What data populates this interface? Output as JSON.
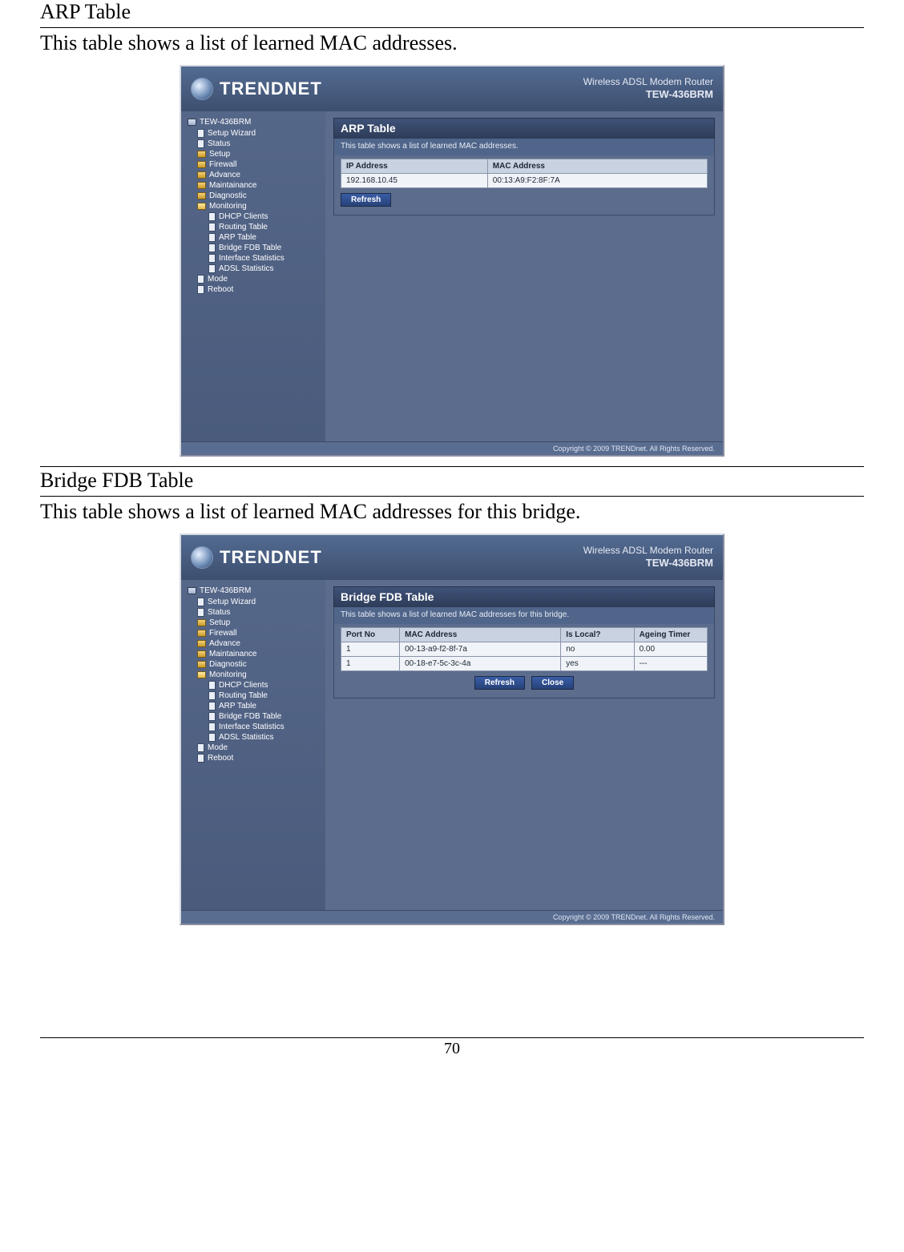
{
  "page": {
    "number": "70"
  },
  "section1": {
    "title": "ARP Table",
    "desc": "This table shows a list of learned MAC addresses."
  },
  "section2": {
    "title": "Bridge FDB Table",
    "desc": "This table shows a list of learned MAC addresses for this bridge."
  },
  "brand": {
    "name": "TRENDNET",
    "product": "Wireless ADSL Modem Router",
    "model": "TEW-436BRM",
    "footer": "Copyright © 2009 TRENDnet. All Rights Reserved."
  },
  "nav": {
    "root": "TEW-436BRM",
    "items": [
      "Setup Wizard",
      "Status",
      "Setup",
      "Firewall",
      "Advance",
      "Maintainance",
      "Diagnostic",
      "Monitoring"
    ],
    "sub": [
      "DHCP Clients",
      "Routing Table",
      "ARP Table",
      "Bridge FDB Table",
      "Interface Statistics",
      "ADSL Statistics"
    ],
    "tail": [
      "Mode",
      "Reboot"
    ]
  },
  "arp": {
    "panelTitle": "ARP Table",
    "panelDesc": "This table shows a list of learned MAC addresses.",
    "headers": {
      "ip": "IP Address",
      "mac": "MAC Address"
    },
    "rows": [
      {
        "ip": "192.168.10.45",
        "mac": "00:13:A9:F2:8F:7A"
      }
    ],
    "refresh": "Refresh"
  },
  "fdb": {
    "panelTitle": "Bridge FDB Table",
    "panelDesc": "This table shows a list of learned MAC addresses for this bridge.",
    "headers": {
      "port": "Port No",
      "mac": "MAC Address",
      "local": "Is Local?",
      "ageing": "Ageing Timer"
    },
    "rows": [
      {
        "port": "1",
        "mac": "00-13-a9-f2-8f-7a",
        "local": "no",
        "ageing": "0.00"
      },
      {
        "port": "1",
        "mac": "00-18-e7-5c-3c-4a",
        "local": "yes",
        "ageing": "---"
      }
    ],
    "refresh": "Refresh",
    "close": "Close"
  }
}
